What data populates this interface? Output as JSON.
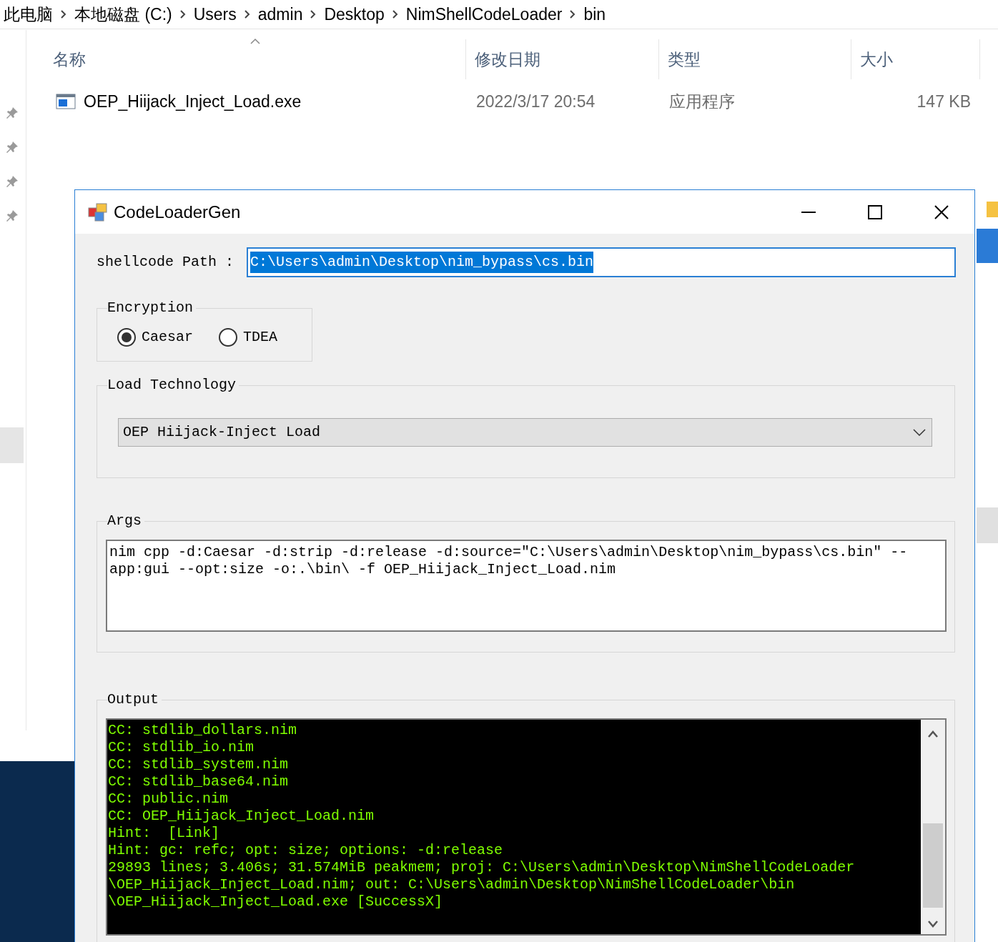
{
  "explorer": {
    "breadcrumb": [
      "此电脑",
      "本地磁盘 (C:)",
      "Users",
      "admin",
      "Desktop",
      "NimShellCodeLoader",
      "bin"
    ],
    "columns": [
      "名称",
      "修改日期",
      "类型",
      "大小"
    ],
    "files": [
      {
        "name": "OEP_Hiijack_Inject_Load.exe",
        "modified": "2022/3/17 20:54",
        "type": "应用程序",
        "size": "147 KB"
      }
    ]
  },
  "dialog": {
    "title": "CodeLoaderGen",
    "path_label": "shellcode Path :",
    "path_value": "C:\\Users\\admin\\Desktop\\nim_bypass\\cs.bin",
    "path_text_selected": true,
    "encryption": {
      "legend": "Encryption",
      "options": [
        {
          "label": "Caesar",
          "selected": true
        },
        {
          "label": "TDEA",
          "selected": false
        }
      ]
    },
    "load_technology": {
      "legend": "Load Technology",
      "value": "OEP Hiijack-Inject Load"
    },
    "args": {
      "legend": "Args",
      "value": "nim cpp -d:Caesar -d:strip -d:release -d:source=\"C:\\Users\\admin\\Desktop\\nim_bypass\\cs.bin\" --app:gui --opt:size -o:.\\bin\\ -f OEP_Hiijack_Inject_Load.nim"
    },
    "output": {
      "legend": "Output",
      "lines": [
        "CC: stdlib_dollars.nim",
        "CC: stdlib_io.nim",
        "CC: stdlib_system.nim",
        "CC: stdlib_base64.nim",
        "CC: public.nim",
        "CC: OEP_Hiijack_Inject_Load.nim",
        "Hint:  [Link]",
        "Hint: gc: refc; opt: size; options: -d:release",
        "29893 lines; 3.406s; 31.574MiB peakmem; proj: C:\\Users\\admin\\Desktop\\NimShellCodeLoader",
        "\\OEP_Hiijack_Inject_Load.nim; out: C:\\Users\\admin\\Desktop\\NimShellCodeLoader\\bin",
        "\\OEP_Hiijack_Inject_Load.exe [SuccessX]"
      ]
    }
  }
}
